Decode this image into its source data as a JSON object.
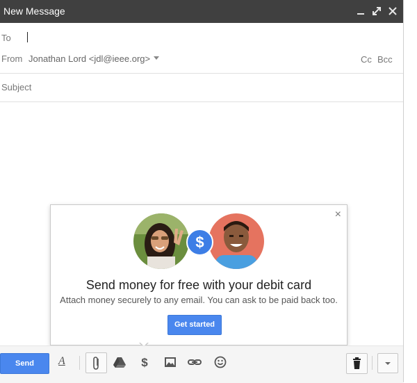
{
  "window": {
    "title": "New Message"
  },
  "fields": {
    "to_label": "To",
    "from_label": "From",
    "from_value": "Jonathan Lord <jdl@ieee.org>",
    "cc_label": "Cc",
    "bcc_label": "Bcc",
    "subject_placeholder": "Subject"
  },
  "promo": {
    "heading": "Send money for free with your debit card",
    "subtext": "Attach money securely to any email. You can ask to be paid back too.",
    "cta_label": "Get started",
    "close_glyph": "×",
    "dollar_glyph": "$"
  },
  "toolbar": {
    "send_label": "Send",
    "format_glyph": "A"
  },
  "colors": {
    "titlebar": "#404040",
    "accent_blue": "#4a87ee",
    "dollar_badge": "#3d7ee6"
  },
  "icons": [
    "minimize-icon",
    "popout-icon",
    "close-icon",
    "attach-icon",
    "drive-icon",
    "dollar-icon",
    "photo-icon",
    "link-icon",
    "emoji-icon",
    "trash-icon",
    "chevron-down-icon"
  ]
}
